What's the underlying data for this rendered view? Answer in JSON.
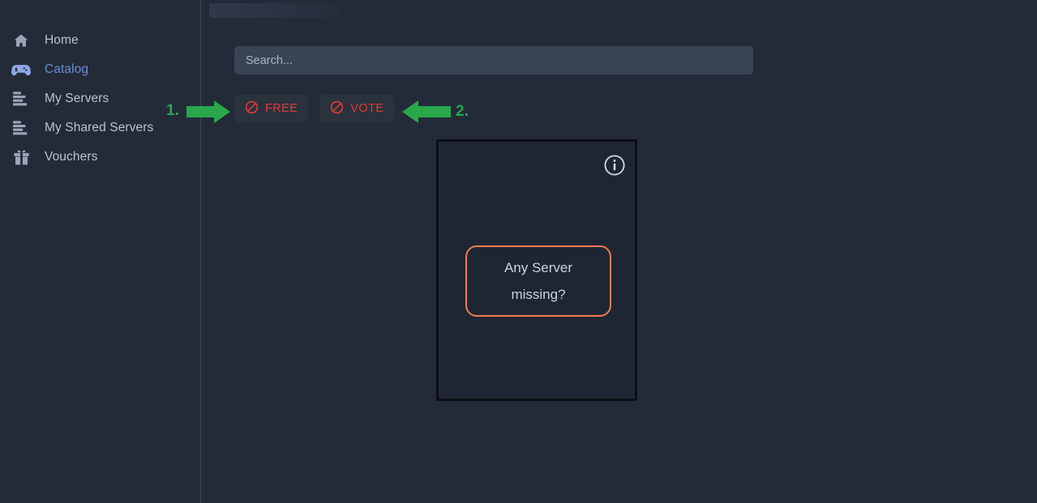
{
  "theme": {
    "page_bg": "#232b39",
    "sidebar_bg": "#232b39",
    "divider": "#3a4654",
    "accent_active": "#6b8dd8",
    "danger": "#e03b35",
    "orange": "#ef7c4e",
    "annotation_green": "#28a74b",
    "card_bg": "#1f2633",
    "card_border": "#0c0e13",
    "input_bg": "#394554",
    "button_bg": "#2a323e",
    "text": "#b9c2cf"
  },
  "header": {
    "ghost_title": ""
  },
  "sidebar": {
    "items": [
      {
        "label": "Home",
        "icon": "home-icon",
        "active": false
      },
      {
        "label": "Catalog",
        "icon": "gamepad-icon",
        "active": true
      },
      {
        "label": "My Servers",
        "icon": "server-list-icon",
        "active": false
      },
      {
        "label": "My Shared Servers",
        "icon": "shared-server-list-icon",
        "active": false
      },
      {
        "label": "Vouchers",
        "icon": "gift-icon",
        "active": false
      }
    ]
  },
  "search": {
    "placeholder": "Search...",
    "value": ""
  },
  "filters": [
    {
      "label": "FREE",
      "icon": "block-icon",
      "state": "disabled-red"
    },
    {
      "label": "VOTE",
      "icon": "block-icon",
      "state": "disabled-red"
    }
  ],
  "card": {
    "info_icon": "info-circle-icon",
    "missing_box": {
      "line1": "Any Server",
      "line2": "missing?"
    }
  },
  "annotations": [
    {
      "number": "1.",
      "direction": "right",
      "target": "free-filter-button"
    },
    {
      "number": "2.",
      "direction": "left",
      "target": "vote-filter-button"
    }
  ]
}
